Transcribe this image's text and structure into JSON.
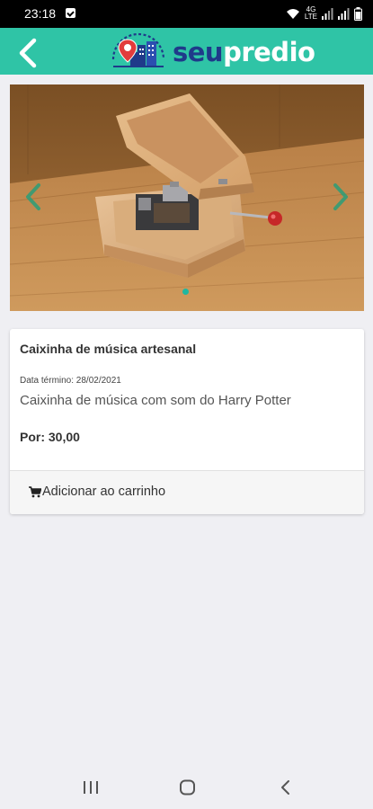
{
  "status_bar": {
    "time": "23:18",
    "network_label": "4G",
    "lte_label": "LTE"
  },
  "header": {
    "brand_part1": "seu",
    "brand_part2": "predio"
  },
  "carousel": {
    "active_slide": 1,
    "slide_count": 1
  },
  "product": {
    "title": "Caixinha de música artesanal",
    "end_date": "Data término: 28/02/2021",
    "description": "Caixinha de música com som do Harry Potter",
    "price": "Por: 30,00",
    "add_to_cart_label": "Adicionar ao carrinho"
  },
  "colors": {
    "header_bg": "#2fc4a6",
    "brand_dark": "#1f3a8a",
    "accent": "#1fb7a0"
  },
  "icons": {
    "back": "chevron-left-icon",
    "cart": "cart-icon",
    "nav_recents": "recents-icon",
    "nav_home": "home-icon",
    "nav_back": "back-triangle-icon"
  }
}
